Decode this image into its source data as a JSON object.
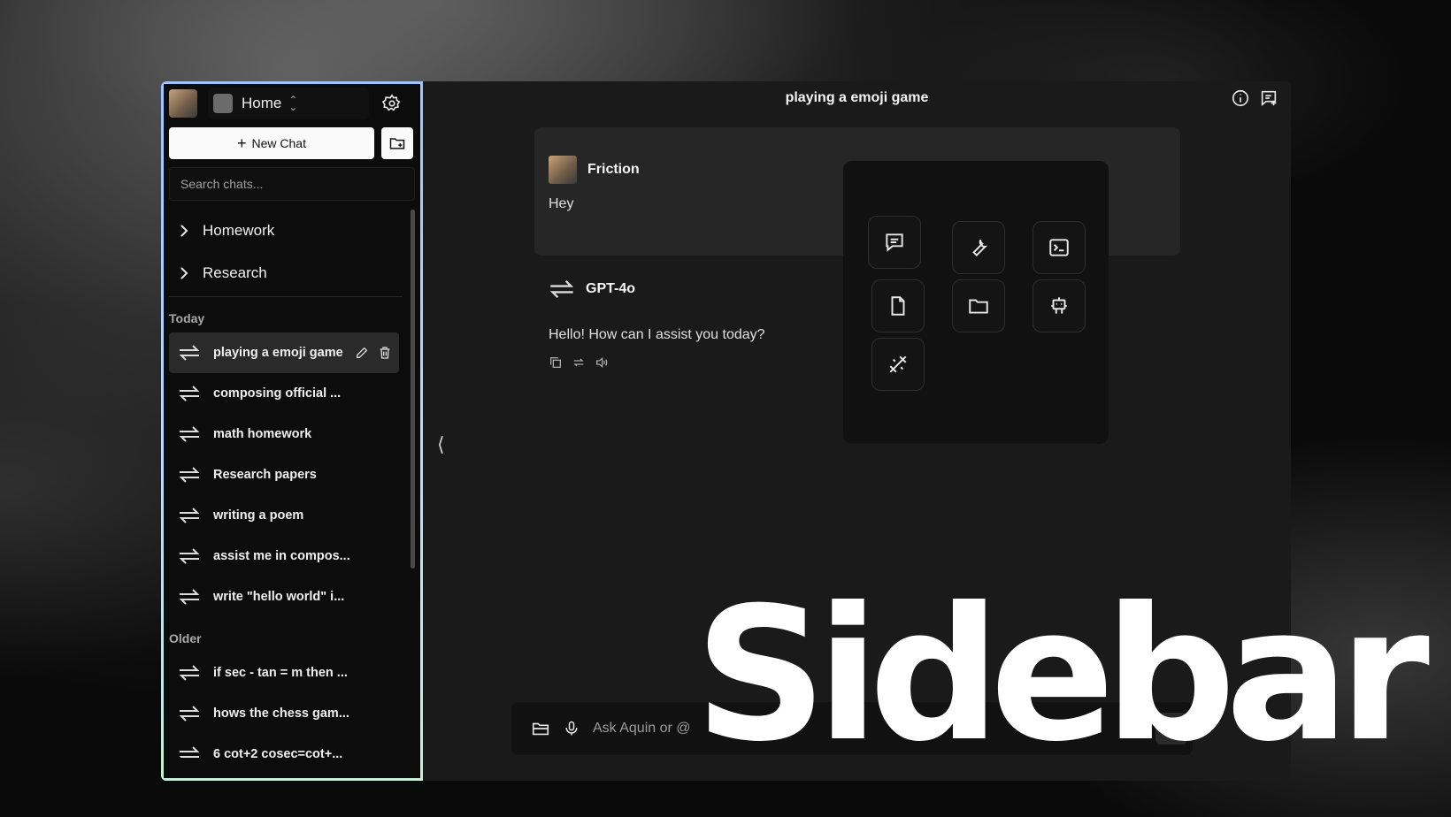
{
  "sidebar": {
    "workspace": "Home",
    "new_chat_label": "New Chat",
    "search_placeholder": "Search chats...",
    "folders": [
      "Homework",
      "Research"
    ],
    "today_label": "Today",
    "today_items": [
      "playing a emoji game",
      "composing official ...",
      "math homework",
      "Research papers",
      "writing a poem",
      "assist me in compos...",
      "write \"hello world\" i..."
    ],
    "older_label": "Older",
    "older_items": [
      "if sec - tan = m then ...",
      "hows the chess gam...",
      "6 cot+2 cosec=cot+..."
    ]
  },
  "main": {
    "title": "playing a emoji game",
    "user_name": "Friction",
    "user_message": "Hey",
    "assistant_name": "GPT-4o",
    "assistant_message": "Hello! How can I assist you today?",
    "input_placeholder": "Ask Aquin or @"
  },
  "tools": [
    "chat-icon",
    "wrench-icon",
    "terminal-icon",
    "file-icon",
    "folder-icon",
    "robot-icon",
    "magic-wand-icon"
  ],
  "overlay": {
    "word": "Sidebar"
  },
  "colors": {
    "border_gradient_top": "#9ec3ff",
    "border_gradient_bottom": "#c7f0d9",
    "app_bg": "#1a1a1a",
    "sidebar_bg": "#0c0c0c"
  }
}
